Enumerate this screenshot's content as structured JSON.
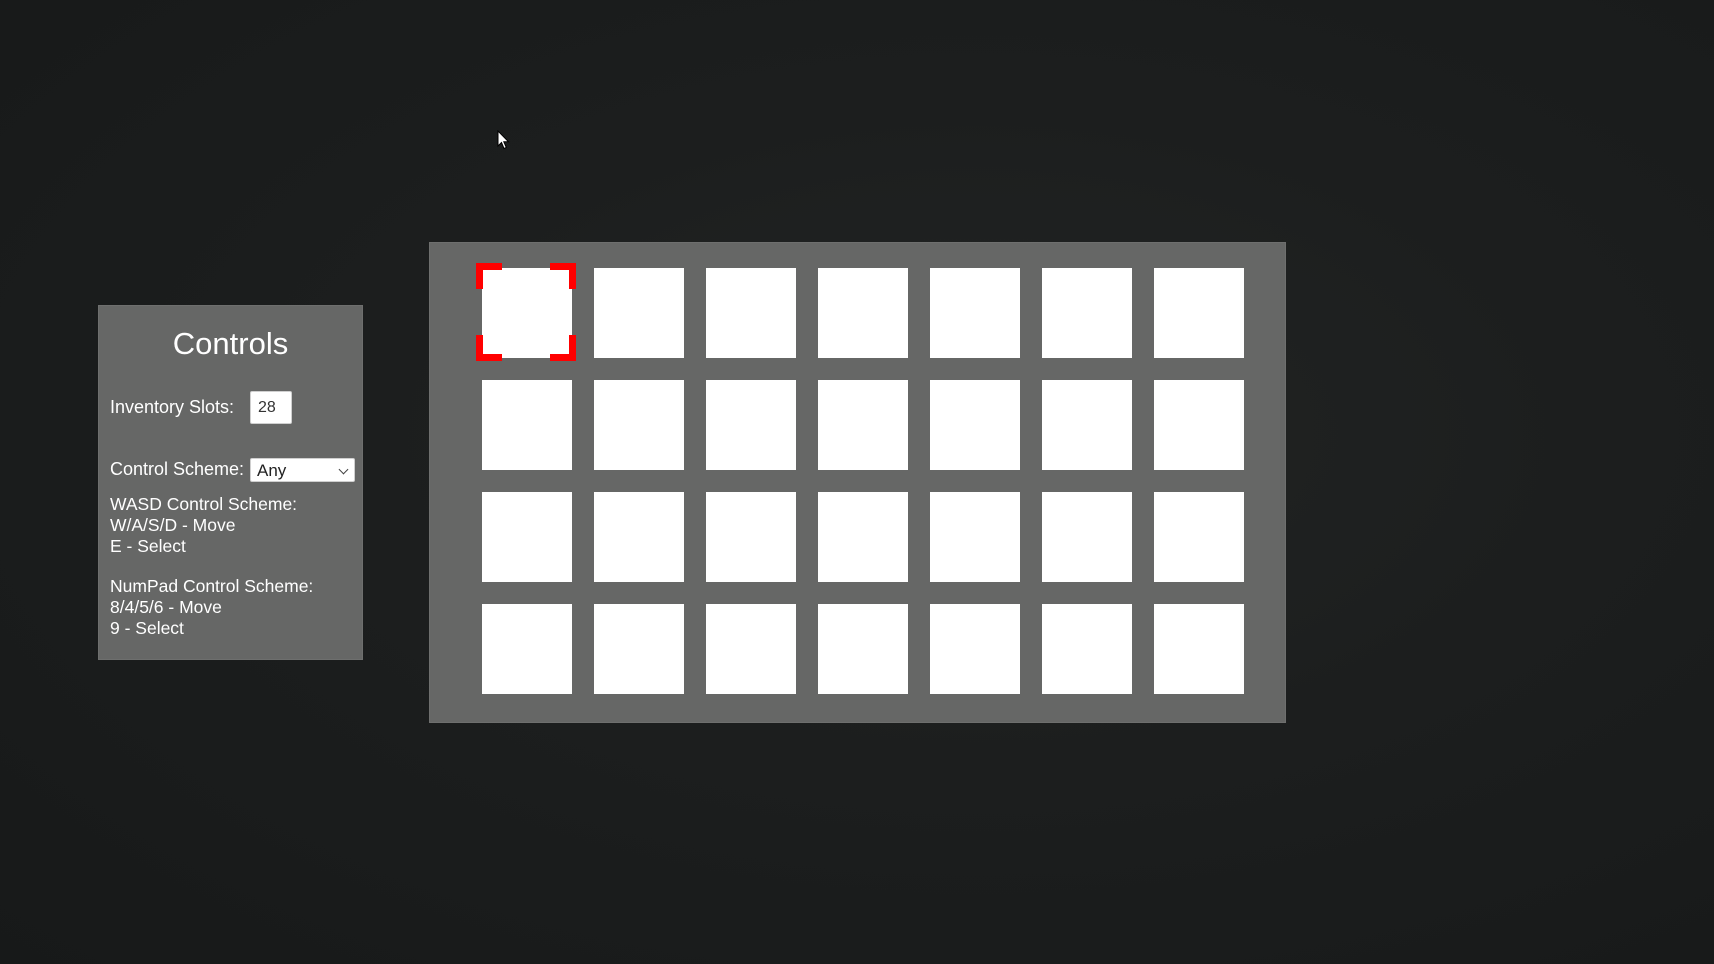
{
  "controls": {
    "title": "Controls",
    "inventory_slots_label": "Inventory Slots:",
    "inventory_slots_value": "28",
    "control_scheme_label": "Control Scheme:",
    "control_scheme_value": "Any",
    "wasd": {
      "heading": "WASD Control Scheme:",
      "move": "W/A/S/D - Move",
      "select": "E - Select"
    },
    "numpad": {
      "heading": "NumPad Control Scheme:",
      "move": "8/4/5/6 - Move",
      "select": "9 - Select"
    }
  },
  "inventory": {
    "rows": 4,
    "columns": 7,
    "selected_slot": 1
  },
  "colors": {
    "background": "#1c1e1e",
    "panel": "#666766",
    "slot": "#ffffff",
    "selector": "#ff0000"
  }
}
